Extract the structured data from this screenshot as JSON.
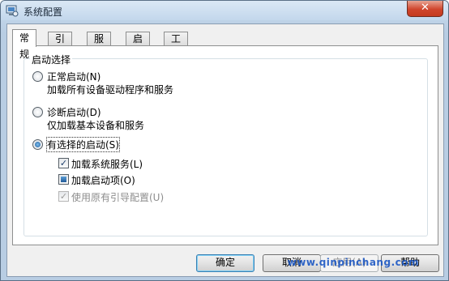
{
  "window": {
    "title": "系统配置",
    "close_glyph": "✕"
  },
  "tabs": [
    {
      "label": "常规",
      "active": true
    },
    {
      "label": "引导",
      "active": false
    },
    {
      "label": "服务",
      "active": false
    },
    {
      "label": "启动",
      "active": false
    },
    {
      "label": "工具",
      "active": false
    }
  ],
  "startup": {
    "group_title": "启动选择",
    "options": [
      {
        "label": "正常启动(N)",
        "description": "加载所有设备驱动程序和服务",
        "selected": false
      },
      {
        "label": "诊断启动(D)",
        "description": "仅加载基本设备和服务",
        "selected": false
      },
      {
        "label": "有选择的启动(S)",
        "description": "",
        "selected": true
      }
    ],
    "checks": [
      {
        "label": "加载系统服务(L)",
        "state": "checked",
        "enabled": true
      },
      {
        "label": "加载启动项(O)",
        "state": "indeterminate",
        "enabled": true
      },
      {
        "label": "使用原有引导配置(U)",
        "state": "checked",
        "enabled": false
      }
    ]
  },
  "buttons": {
    "ok": "确定",
    "cancel": "取消",
    "apply": "应用(A)",
    "help": "帮助"
  },
  "watermark": "www.qinpinchang.com",
  "colors": {
    "accent": "#1c5a9c",
    "close_button": "#c43a1f",
    "watermark": "#1b57c4"
  }
}
